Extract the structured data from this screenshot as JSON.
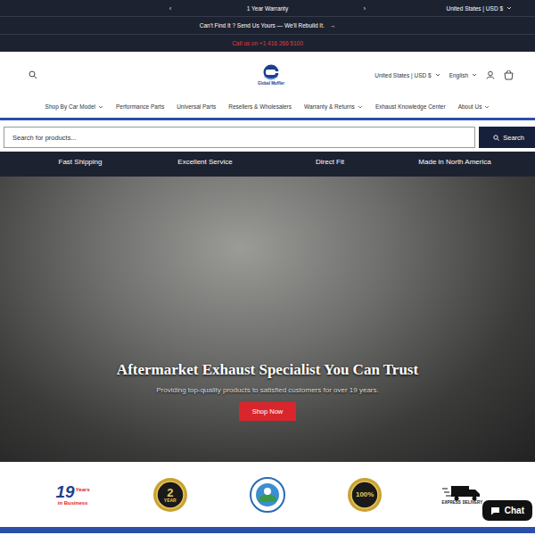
{
  "announcement": {
    "prev": "‹",
    "text": "1 Year Warranty",
    "next": "›",
    "country": "United States | USD $"
  },
  "promo": {
    "text": "Can't Find It ? Send Us Yours — We'll Rebuild It.",
    "arrow": "→"
  },
  "call": {
    "text": "Call us on +1 416 266 5100"
  },
  "header": {
    "logo": "Global Muffler",
    "country": "United States | USD $",
    "language": "English"
  },
  "nav": [
    {
      "label": "Shop By Car Model",
      "dropdown": true
    },
    {
      "label": "Performance Parts",
      "dropdown": false
    },
    {
      "label": "Universal Parts",
      "dropdown": false
    },
    {
      "label": "Resellers & Wholesalers",
      "dropdown": false
    },
    {
      "label": "Warranty & Returns",
      "dropdown": true
    },
    {
      "label": "Exhaust Knowledge Center",
      "dropdown": false
    },
    {
      "label": "About Us",
      "dropdown": true
    }
  ],
  "search": {
    "placeholder": "Search for products...",
    "button": "Search"
  },
  "features": [
    "Fast Shipping",
    "Excellent Service",
    "Direct Fit",
    "Made in North America"
  ],
  "hero": {
    "title": "Aftermarket Exhaust Specialist You Can Trust",
    "subtitle": "Providing top-quality products to satisfied customers for over 19 years.",
    "button": "Shop Now"
  },
  "badges": [
    {
      "kind": "years",
      "lines": [
        "19",
        "Years",
        "in Business"
      ]
    },
    {
      "kind": "warranty",
      "lines": [
        "2",
        "YEAR"
      ]
    },
    {
      "kind": "seal",
      "lines": []
    },
    {
      "kind": "guarantee",
      "lines": [
        "100%"
      ]
    },
    {
      "kind": "delivery",
      "lines": [
        "EXPRESS",
        "DELIVERY"
      ]
    }
  ],
  "chat": {
    "label": "Chat"
  }
}
